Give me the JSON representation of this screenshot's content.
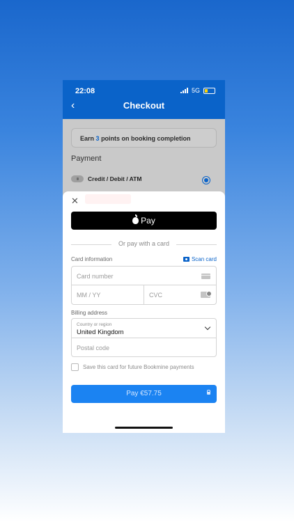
{
  "status": {
    "time": "22:08",
    "network": "5G"
  },
  "header": {
    "title": "Checkout"
  },
  "points": {
    "prefix": "Earn",
    "value": "3",
    "suffix": "points on booking completion"
  },
  "payment": {
    "label": "Payment",
    "method_label": "Credit / Debit / ATM",
    "selected": true
  },
  "sheet": {
    "apple_pay_label": "Pay",
    "divider_text": "Or pay with a card",
    "card_info_label": "Card information",
    "scan_card_label": "Scan card",
    "card_number_placeholder": "Card number",
    "expiry_placeholder": "MM / YY",
    "cvc_placeholder": "CVC",
    "billing_label": "Billing address",
    "country_label": "Country or region",
    "country_value": "United Kingdom",
    "postal_placeholder": "Postal code",
    "save_card_label": "Save this card for future Bookmine payments",
    "pay_button_label": "Pay €57.75"
  },
  "colors": {
    "brand_blue": "#0a63c9",
    "pay_button": "#1b83f2",
    "apple_pay_bg": "#000000"
  }
}
